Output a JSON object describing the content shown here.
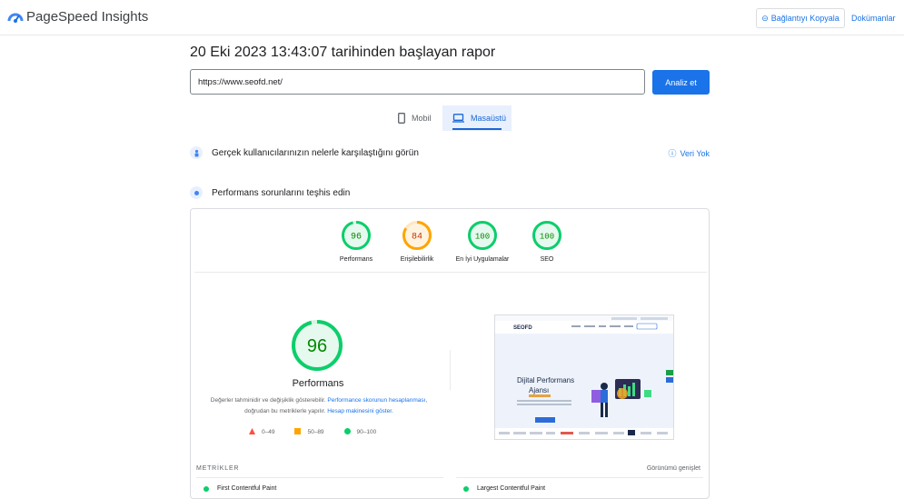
{
  "header": {
    "brand": "PageSpeed Insights",
    "copy_link_label": "Bağlantıyı Kopyala",
    "docs_label": "Dokümanlar"
  },
  "report": {
    "title": "20 Eki 2023 13:43:07 tarihinden başlayan rapor",
    "url_value": "https://www.seofd.net/",
    "analyze_label": "Analiz et"
  },
  "tabs": [
    {
      "label": "Mobil",
      "active": false
    },
    {
      "label": "Masaüstü",
      "active": true
    }
  ],
  "field_data": {
    "heading": "Gerçek kullanıcılarınızın nelerle karşılaştığını görün",
    "status": "Veri Yok"
  },
  "diagnose": {
    "heading": "Performans sorunlarını teşhis edin"
  },
  "scores": [
    {
      "label": "Performans",
      "value": "96",
      "fraction": 0.96,
      "color": "#0cce6b",
      "text_color": "#008800"
    },
    {
      "label": "Erişilebilirlik",
      "value": "84",
      "fraction": 0.84,
      "color": "#ffa400",
      "text_color": "#c33300"
    },
    {
      "label": "En İyi Uygulamalar",
      "value": "100",
      "fraction": 1.0,
      "color": "#0cce6b",
      "text_color": "#008800"
    },
    {
      "label": "SEO",
      "value": "100",
      "fraction": 1.0,
      "color": "#0cce6b",
      "text_color": "#008800"
    }
  ],
  "main_score": {
    "value": "96",
    "fraction": 0.96,
    "title": "Performans",
    "desc_prefix": "Değerler tahminidir ve değişiklik gösterebilir. ",
    "desc_link1": "Performance skorunun hesaplanması",
    "desc_middle": ", doğrudan bu metriklerle yapılır. ",
    "desc_link2": "Hesap makinesini göster."
  },
  "legend": [
    {
      "symbol": "triangle",
      "range": "0–49",
      "color": "#ff4e42"
    },
    {
      "symbol": "square",
      "range": "50–89",
      "color": "#ffa400"
    },
    {
      "symbol": "circle",
      "range": "90–100",
      "color": "#0cce6b"
    }
  ],
  "preview": {
    "logo": "SEOFD",
    "hero_line1": "Dijital Performans",
    "hero_line2": "Ajansı"
  },
  "metrics": {
    "title": "METRİKLER",
    "expand_label": "Görünümü genişlet",
    "items": [
      {
        "label": "First Contentful Paint"
      },
      {
        "label": "Largest Contentful Paint"
      }
    ]
  }
}
